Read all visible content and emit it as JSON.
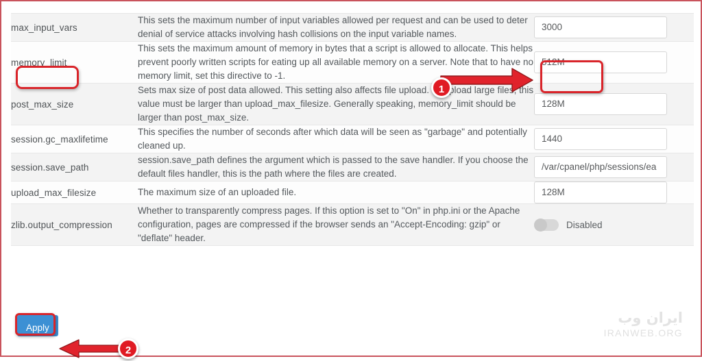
{
  "page": {
    "border_color": "#c9535c",
    "accent_blue": "#3c90d4",
    "annotation_red": "#d9242a"
  },
  "settings_rows": [
    {
      "name": "max_input_vars",
      "description": "This sets the maximum number of input variables allowed per request and can be used to deter denial of service attacks involving hash collisions on the input variable names.",
      "control": "input",
      "value": "3000"
    },
    {
      "name": "memory_limit",
      "description": "This sets the maximum amount of memory in bytes that a script is allowed to allocate. This helps prevent poorly written scripts for eating up all available memory on a server. Note that to have no memory limit, set this directive to -1.",
      "control": "input",
      "value": "512M"
    },
    {
      "name": "post_max_size",
      "description": "Sets max size of post data allowed. This setting also affects file upload. To upload large files, this value must be larger than upload_max_filesize. Generally speaking, memory_limit should be larger than post_max_size.",
      "control": "input",
      "value": "128M"
    },
    {
      "name": "session.gc_maxlifetime",
      "description": "This specifies the number of seconds after which data will be seen as \"garbage\" and potentially cleaned up.",
      "control": "input",
      "value": "1440"
    },
    {
      "name": "session.save_path",
      "description": "session.save_path defines the argument which is passed to the save handler. If you choose the default files handler, this is the path where the files are created.",
      "control": "input",
      "value": "/var/cpanel/php/sessions/ea"
    },
    {
      "name": "upload_max_filesize",
      "description": "The maximum size of an uploaded file.",
      "control": "input",
      "value": "128M"
    },
    {
      "name": "zlib.output_compression",
      "description": "Whether to transparently compress pages. If this option is set to \"On\" in php.ini or the Apache configuration, pages are compressed if the browser sends an \"Accept-Encoding: gzip\" or \"deflate\" header.",
      "control": "toggle",
      "value": "Disabled",
      "toggle_state": "off"
    }
  ],
  "footer": {
    "apply_label": "Apply",
    "watermark_fa": "ایران وب",
    "watermark_en": "IRANWEB.ORG"
  },
  "annotations": {
    "badge_1": "1",
    "badge_2": "2"
  }
}
